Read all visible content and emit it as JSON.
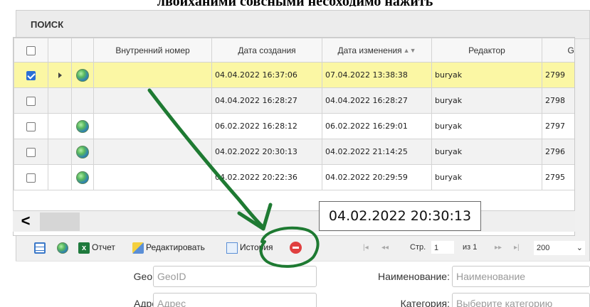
{
  "top_text": "лвоиханими совсными несоходимо нажить",
  "panel": {
    "title": "ПОИСК"
  },
  "grid": {
    "columns": [
      "",
      "",
      "",
      "Внутренний номер",
      "Дата создания",
      "Дата изменения",
      "Редактор",
      "GeoI"
    ],
    "rows": [
      {
        "checked": true,
        "expander": true,
        "globe": true,
        "internal": "",
        "created": "04.04.2022 16:37:06",
        "modified": "07.04.2022 13:38:38",
        "editor": "buryak",
        "geo": "2799"
      },
      {
        "checked": false,
        "expander": false,
        "globe": false,
        "internal": "",
        "created": "04.04.2022 16:28:27",
        "modified": "04.04.2022 16:28:27",
        "editor": "buryak",
        "geo": "2798"
      },
      {
        "checked": false,
        "expander": false,
        "globe": true,
        "internal": "",
        "created": "06.02.2022 16:28:12",
        "modified": "06.02.2022 16:29:01",
        "editor": "buryak",
        "geo": "2797"
      },
      {
        "checked": false,
        "expander": false,
        "globe": true,
        "internal": "",
        "created": "04.02.2022 20:30:13",
        "modified": "04.02.2022 21:14:25",
        "editor": "buryak",
        "geo": "2796"
      },
      {
        "checked": false,
        "expander": false,
        "globe": true,
        "internal": "",
        "created": "04.02.2022 20:22:36",
        "modified": "04.02.2022 20:29:59",
        "editor": "buryak",
        "geo": "2795"
      }
    ],
    "scroll_left": "<"
  },
  "tooltip": {
    "text": "04.02.2022 20:30:13"
  },
  "toolbar": {
    "report_label": "Отчет",
    "edit_label": "Редактировать",
    "history_label": "История",
    "icons": [
      "list-icon",
      "globe-icon",
      "excel-icon",
      "edit-icon",
      "history-icon",
      "delete-icon"
    ]
  },
  "pager": {
    "first": "|◂",
    "prev": "◂◂",
    "page_label": "Стр.",
    "page_value": "1",
    "of_label": "из 1",
    "next": "▸▸",
    "last": "▸|",
    "page_size": "200"
  },
  "form": {
    "geoid_label": "GeoID:",
    "geoid_placeholder": "GeoID",
    "name_label": "Наименование:",
    "name_placeholder": "Наименование",
    "address_label": "Адрес:",
    "address_placeholder": "Адрес",
    "category_label": "Категория:",
    "category_placeholder": "Выберите категорию"
  },
  "colors": {
    "selected_row": "#fbf7a4",
    "annotation": "#1e7a32",
    "delete": "#e04040"
  }
}
